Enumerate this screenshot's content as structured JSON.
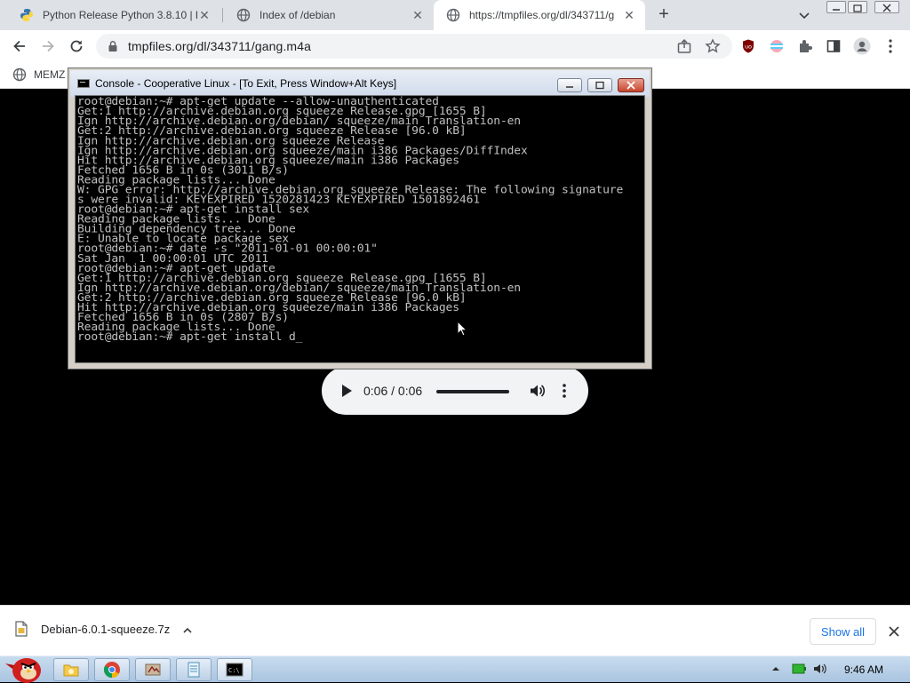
{
  "tabs": [
    {
      "title": "Python Release Python 3.8.10 | P",
      "icon": "python-icon",
      "active": false
    },
    {
      "title": "Index of /debian",
      "icon": "globe-icon",
      "active": false
    },
    {
      "title": "https://tmpfiles.org/dl/343711/g",
      "icon": "globe-icon",
      "active": true
    }
  ],
  "toolbar": {
    "url": "tmpfiles.org/dl/343711/gang.m4a"
  },
  "bookmarks": [
    {
      "label": "MEMZ",
      "icon": "globe-icon"
    }
  ],
  "console": {
    "title": "Console - Cooperative Linux - [To Exit, Press Window+Alt Keys]",
    "lines": [
      "root@debian:~# apt-get update --allow-unauthenticated",
      "Get:1 http://archive.debian.org squeeze Release.gpg [1655 B]",
      "Ign http://archive.debian.org/debian/ squeeze/main Translation-en",
      "Get:2 http://archive.debian.org squeeze Release [96.0 kB]",
      "Ign http://archive.debian.org squeeze Release",
      "Ign http://archive.debian.org squeeze/main i386 Packages/DiffIndex",
      "Hit http://archive.debian.org squeeze/main i386 Packages",
      "Fetched 1656 B in 0s (3011 B/s)",
      "Reading package lists... Done",
      "W: GPG error: http://archive.debian.org squeeze Release: The following signature",
      "s were invalid: KEYEXPIRED 1520281423 KEYEXPIRED 1501892461",
      "root@debian:~# apt-get install sex",
      "Reading package lists... Done",
      "Building dependency tree... Done",
      "E: Unable to locate package sex",
      "root@debian:~# date -s \"2011-01-01 00:00:01\"",
      "Sat Jan  1 00:00:01 UTC 2011",
      "root@debian:~# apt-get update",
      "Get:1 http://archive.debian.org squeeze Release.gpg [1655 B]",
      "Ign http://archive.debian.org/debian/ squeeze/main Translation-en",
      "Get:2 http://archive.debian.org squeeze Release [96.0 kB]",
      "Hit http://archive.debian.org squeeze/main i386 Packages",
      "Fetched 1656 B in 0s (2807 B/s)",
      "Reading package lists... Done",
      "root@debian:~# apt-get install d_"
    ]
  },
  "player": {
    "time": "0:06 / 0:06",
    "progress_fraction": 1.0
  },
  "downloads": {
    "filename": "Debian-6.0.1-squeeze.7z",
    "show_all": "Show all"
  },
  "taskbar": {
    "clock": "9:46 AM",
    "items": [
      "explorer-icon",
      "chrome-icon",
      "app-icon",
      "notepad-icon",
      "console-icon"
    ]
  },
  "colors": {
    "tabstrip": "#dee1e6",
    "accent": "#1a73e8",
    "console_text": "#c0c0c0",
    "taskbar": "#b9d1ea"
  }
}
